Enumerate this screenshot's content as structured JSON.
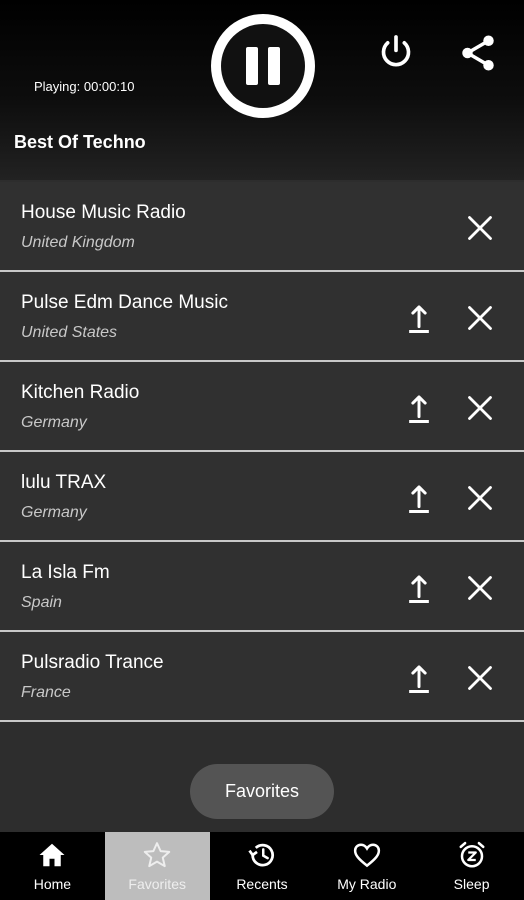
{
  "player": {
    "status_text": "Playing: 00:00:10",
    "station_title": "Best Of Techno"
  },
  "stations": [
    {
      "name": "House Music Radio",
      "country": "United Kingdom",
      "can_move_up": false
    },
    {
      "name": "Pulse Edm Dance Music",
      "country": "United States",
      "can_move_up": true
    },
    {
      "name": "Kitchen Radio",
      "country": "Germany",
      "can_move_up": true
    },
    {
      "name": "lulu TRAX",
      "country": "Germany",
      "can_move_up": true
    },
    {
      "name": "La Isla Fm",
      "country": "Spain",
      "can_move_up": true
    },
    {
      "name": "Pulsradio Trance",
      "country": "France",
      "can_move_up": true
    }
  ],
  "toast": "Favorites",
  "nav": [
    {
      "label": "Home",
      "icon": "home-icon",
      "active": false
    },
    {
      "label": "Favorites",
      "icon": "star-icon",
      "active": true
    },
    {
      "label": "Recents",
      "icon": "history-icon",
      "active": false
    },
    {
      "label": "My Radio",
      "icon": "heart-icon",
      "active": false
    },
    {
      "label": "Sleep",
      "icon": "alarm-icon",
      "active": false
    }
  ]
}
